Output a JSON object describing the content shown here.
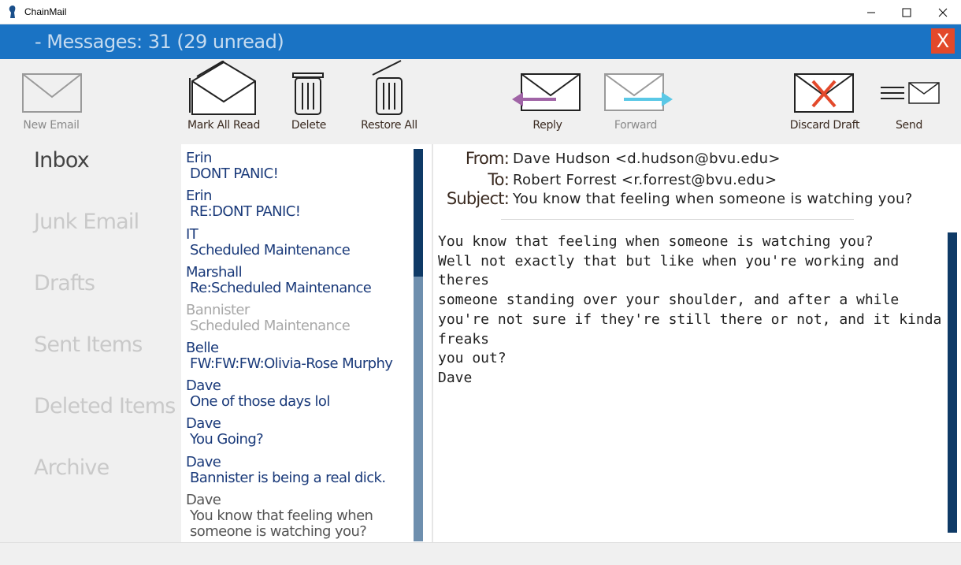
{
  "window": {
    "title": "ChainMail"
  },
  "appbar": {
    "count_text": "- Messages: 31 (29 unread)",
    "close_label": "X"
  },
  "toolbar": {
    "new_email": "New Email",
    "mark_all_read": "Mark All Read",
    "delete": "Delete",
    "restore_all": "Restore All",
    "reply": "Reply",
    "forward": "Forward",
    "discard_draft": "Discard Draft",
    "send": "Send"
  },
  "folders": [
    "Inbox",
    "Junk Email",
    "Drafts",
    "Sent Items",
    "Deleted Items",
    "Archive"
  ],
  "messages": [
    {
      "sender": "Erin",
      "subject": "DONT PANIC!"
    },
    {
      "sender": "Erin",
      "subject": "RE:DONT PANIC!"
    },
    {
      "sender": "IT",
      "subject": "Scheduled Maintenance"
    },
    {
      "sender": "Marshall",
      "subject": "Re:Scheduled Maintenance"
    },
    {
      "sender": "Bannister",
      "subject": "Scheduled Maintenance"
    },
    {
      "sender": "Belle",
      "subject": "FW:FW:FW:Olivia-Rose Murphy"
    },
    {
      "sender": "Dave",
      "subject": "One of those days lol"
    },
    {
      "sender": "Dave",
      "subject": "You Going?"
    },
    {
      "sender": "Dave",
      "subject": "Bannister is being a real dick."
    },
    {
      "sender": "Dave",
      "subject": "You know that feeling when someone is watching you?"
    }
  ],
  "email": {
    "from_label": "From:",
    "from": "Dave Hudson <d.hudson@bvu.edu>",
    "to_label": "To:",
    "to": "Robert Forrest <r.forrest@bvu.edu>",
    "subject_label": "Subject:",
    "subject": "You know that feeling when someone is watching you?",
    "body": "You know that feeling when someone is watching you?\nWell not exactly that but like when you're working and theres\nsomeone standing over your shoulder, and after a while\nyou're not sure if they're still there or not, and it kinda freaks\nyou out?\nDave"
  },
  "colors": {
    "header_blue": "#1a73c4",
    "close_red": "#e3492b",
    "unread_text": "#1a3a7a",
    "reply_arrow": "#a064a6",
    "forward_arrow": "#5ac8e6"
  }
}
